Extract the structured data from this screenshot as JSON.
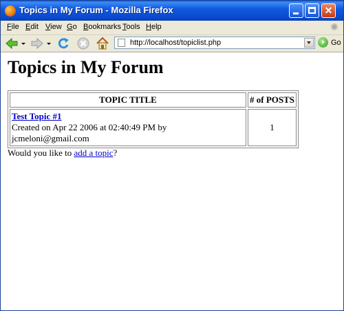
{
  "window": {
    "title": "Topics in My Forum - Mozilla Firefox"
  },
  "menu": {
    "items": [
      "File",
      "Edit",
      "View",
      "Go",
      "Bookmarks",
      "Tools",
      "Help"
    ],
    "mnemonics": [
      "F",
      "E",
      "V",
      "G",
      "B",
      "T",
      "H"
    ]
  },
  "toolbar": {
    "url": "http://localhost/topiclist.php",
    "go_label": "Go"
  },
  "page": {
    "heading": "Topics in My Forum",
    "table": {
      "headers": [
        "TOPIC TITLE",
        "# of POSTS"
      ],
      "rows": [
        {
          "title": "Test Topic #1",
          "meta": "Created on Apr 22 2006 at 02:40:49 PM by jcmeloni@gmail.com",
          "posts": "1"
        }
      ]
    },
    "footer": {
      "prefix": "Would you like to ",
      "link": "add a topic",
      "suffix": "?"
    }
  },
  "icons": {
    "app": "firefox-icon",
    "back": "back-arrow-icon",
    "forward": "forward-arrow-icon",
    "reload": "reload-icon",
    "stop": "stop-icon",
    "home": "home-icon",
    "go": "go-icon",
    "throbber": "throbber-icon"
  },
  "colors": {
    "titlebar": "#0849cc",
    "link": "#0000cc",
    "chrome": "#ece9d8"
  }
}
